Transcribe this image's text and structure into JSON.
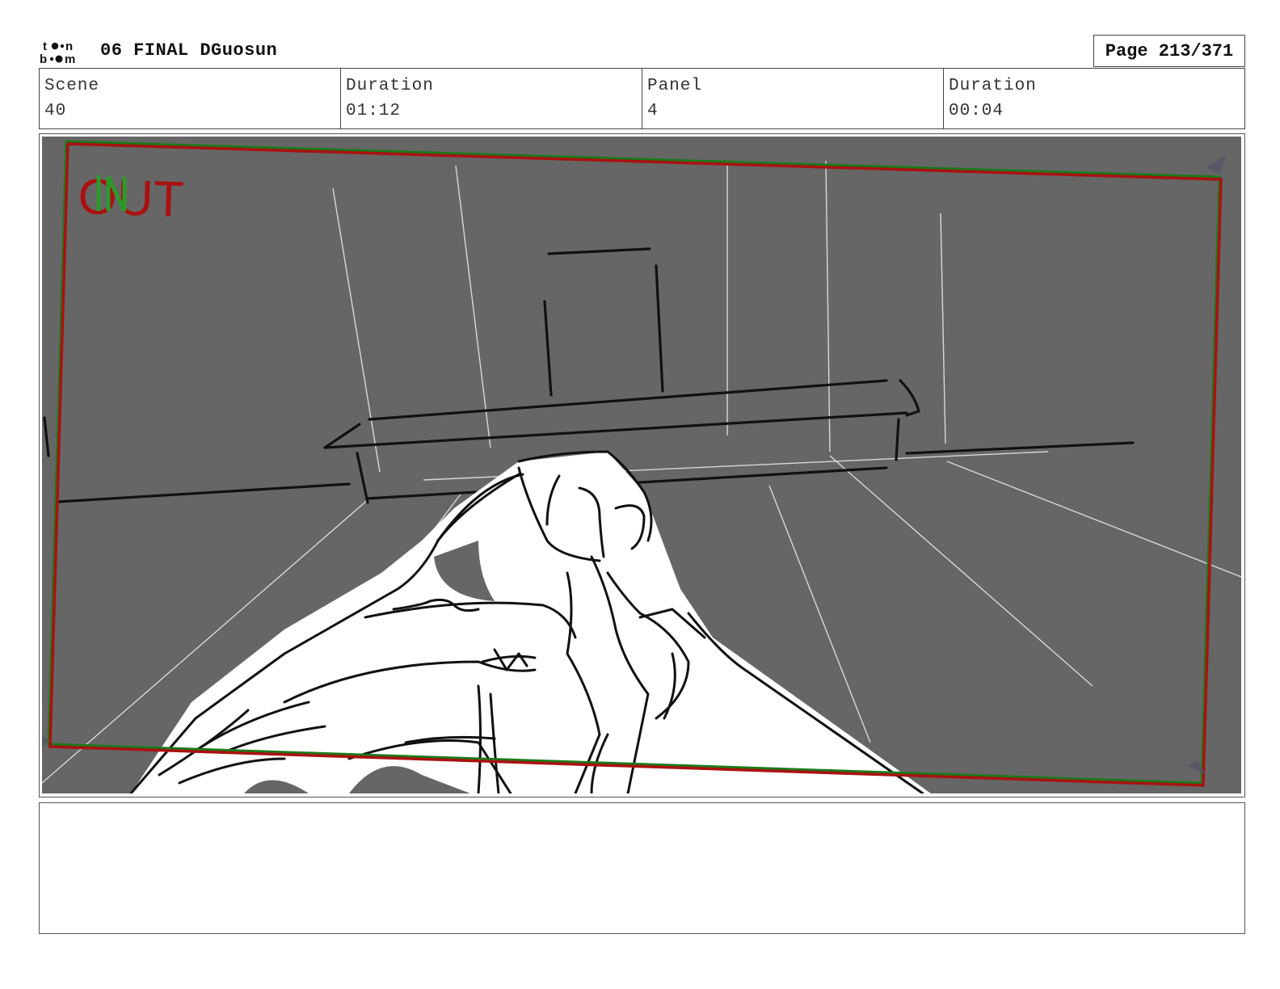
{
  "header": {
    "logo_text": "toon boom",
    "title": "06 FINAL DGuosun",
    "page_label": "Page 213/371"
  },
  "info": [
    {
      "label": "Scene",
      "value": "40"
    },
    {
      "label": "Duration",
      "value": "01:12"
    },
    {
      "label": "Panel",
      "value": "4"
    },
    {
      "label": "Duration",
      "value": "00:04"
    }
  ],
  "panel": {
    "overlay_text": "OUT",
    "background_color": "#666666",
    "frame_color": "#aa1111",
    "guide_color": "#1a7a1a"
  },
  "notes": {
    "text": ""
  }
}
